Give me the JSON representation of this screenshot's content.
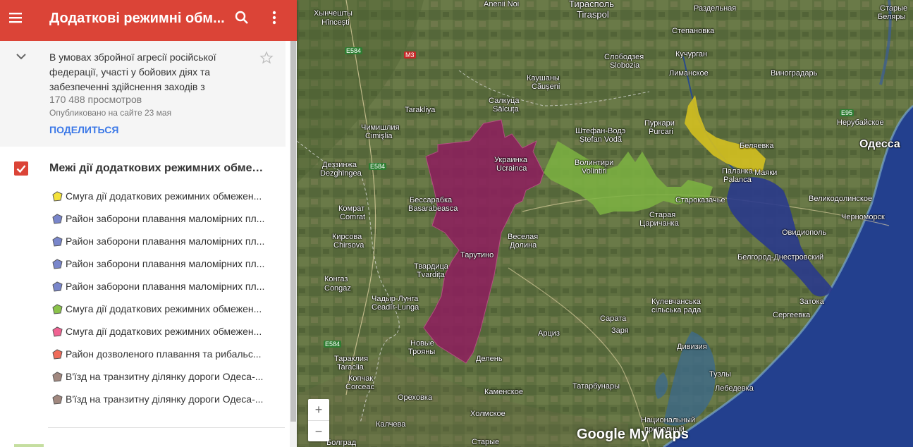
{
  "app": {
    "title": "Додаткові режимні обм...",
    "description": "В умовах збройної агресії російської федерації, участі у бойових діях та забезпеченні здійснення заходів з",
    "views": "170 488 просмотров",
    "published": "Опубликовано на сайте 23 мая",
    "share_label": "ПОДЕЛИТЬСЯ"
  },
  "layer": {
    "title": "Межі дії додаткових режимних обмеж...",
    "items": [
      {
        "label": "Смуга дії додаткових режимних обмежен...",
        "color": "#f4e23b"
      },
      {
        "label": "Район заборони плавання маломірних пл...",
        "color": "#7986cb"
      },
      {
        "label": "Район заборони плавання маломірних пл...",
        "color": "#7986cb"
      },
      {
        "label": "Район заборони плавання маломірних пл...",
        "color": "#7986cb"
      },
      {
        "label": "Район заборони плавання маломірних пл...",
        "color": "#7986cb"
      },
      {
        "label": "Смуга дії додаткових режимних обмежен...",
        "color": "#8bc34a"
      },
      {
        "label": "Смуга дії додаткових режимних обмежен...",
        "color": "#f06292"
      },
      {
        "label": "Район дозволеного плавання та рибальс...",
        "color": "#ef6c5a"
      },
      {
        "label": "В'їзд на транзитну ділянку дороги Одеса-...",
        "color": "#a1887f"
      },
      {
        "label": "В'їзд на транзитну ділянку дороги Одеса-...",
        "color": "#a1887f"
      }
    ]
  },
  "map": {
    "zoom_in": "+",
    "zoom_out": "−",
    "branding": "Google My Maps",
    "colors": {
      "yellow_zone": "#d4c020",
      "green_zone": "#7cb342",
      "purple_zone": "#8e1d5e",
      "blue_zone": "#2a3a8c",
      "sea": "#23408e"
    },
    "roads": [
      "E584",
      "M3",
      "E584",
      "E584",
      "E95"
    ],
    "places": [
      {
        "name": "Anenii Noi",
        "cls": ""
      },
      {
        "name": "Тирасполь",
        "cls": "mid"
      },
      {
        "name": "Tiraspol",
        "cls": "mid"
      },
      {
        "name": "Раздельная",
        "cls": ""
      },
      {
        "name": "Старые",
        "cls": ""
      },
      {
        "name": "Беляры",
        "cls": ""
      },
      {
        "name": "Хынчешты",
        "cls": ""
      },
      {
        "name": "Hîncești",
        "cls": ""
      },
      {
        "name": "Степановка",
        "cls": ""
      },
      {
        "name": "Кучурган",
        "cls": ""
      },
      {
        "name": "Слободзея",
        "cls": ""
      },
      {
        "name": "Slobozia",
        "cls": ""
      },
      {
        "name": "Лиманское",
        "cls": ""
      },
      {
        "name": "Виноградарь",
        "cls": ""
      },
      {
        "name": "Каушаны",
        "cls": ""
      },
      {
        "name": "Căușeni",
        "cls": ""
      },
      {
        "name": "Салкуца",
        "cls": ""
      },
      {
        "name": "Sălcuța",
        "cls": ""
      },
      {
        "name": "Tarakliya",
        "cls": ""
      },
      {
        "name": "Чимишлия",
        "cls": ""
      },
      {
        "name": "Cimişlia",
        "cls": ""
      },
      {
        "name": "Пуркари",
        "cls": ""
      },
      {
        "name": "Purcari",
        "cls": ""
      },
      {
        "name": "Штефан-Водэ",
        "cls": ""
      },
      {
        "name": "Ștefan Vodă",
        "cls": ""
      },
      {
        "name": "Нерубайское",
        "cls": ""
      },
      {
        "name": "Беляевка",
        "cls": ""
      },
      {
        "name": "Одесса",
        "cls": "big"
      },
      {
        "name": "Деззинжа",
        "cls": ""
      },
      {
        "name": "Dezghingea",
        "cls": ""
      },
      {
        "name": "Украинка",
        "cls": ""
      },
      {
        "name": "Ucrainca",
        "cls": ""
      },
      {
        "name": "Волинтири",
        "cls": ""
      },
      {
        "name": "Volintiri",
        "cls": ""
      },
      {
        "name": "Паланка",
        "cls": ""
      },
      {
        "name": "Palanca",
        "cls": ""
      },
      {
        "name": "Маяки",
        "cls": ""
      },
      {
        "name": "Бессарабка",
        "cls": ""
      },
      {
        "name": "Basarabeasca",
        "cls": ""
      },
      {
        "name": "Старокaзачье",
        "cls": ""
      },
      {
        "name": "Великодолинское",
        "cls": ""
      },
      {
        "name": "Комрат",
        "cls": ""
      },
      {
        "name": "Comrat",
        "cls": ""
      },
      {
        "name": "Старая",
        "cls": ""
      },
      {
        "name": "Царичанка",
        "cls": ""
      },
      {
        "name": "Черноморск",
        "cls": ""
      },
      {
        "name": "Кирсова",
        "cls": ""
      },
      {
        "name": "Chirsova",
        "cls": ""
      },
      {
        "name": "Веселая",
        "cls": ""
      },
      {
        "name": "Долина",
        "cls": ""
      },
      {
        "name": "Овидиополь",
        "cls": ""
      },
      {
        "name": "Тарутино",
        "cls": ""
      },
      {
        "name": "Белгород-Днестровский",
        "cls": ""
      },
      {
        "name": "Твардица",
        "cls": ""
      },
      {
        "name": "Tvardița",
        "cls": ""
      },
      {
        "name": "Конгаз",
        "cls": ""
      },
      {
        "name": "Congaz",
        "cls": ""
      },
      {
        "name": "Кулевчанська",
        "cls": ""
      },
      {
        "name": "сільська рада",
        "cls": ""
      },
      {
        "name": "Затока",
        "cls": ""
      },
      {
        "name": "Чадыр-Лунга",
        "cls": ""
      },
      {
        "name": "Ceadîr-Lunga",
        "cls": ""
      },
      {
        "name": "Сарата",
        "cls": ""
      },
      {
        "name": "Заря",
        "cls": ""
      },
      {
        "name": "Сергеевка",
        "cls": ""
      },
      {
        "name": "Арциз",
        "cls": ""
      },
      {
        "name": "Новые",
        "cls": ""
      },
      {
        "name": "Трояны",
        "cls": ""
      },
      {
        "name": "Дивизия",
        "cls": ""
      },
      {
        "name": "Тараклия",
        "cls": ""
      },
      {
        "name": "Taraclia",
        "cls": ""
      },
      {
        "name": "Делень",
        "cls": ""
      },
      {
        "name": "Копчак",
        "cls": ""
      },
      {
        "name": "Corсеас",
        "cls": ""
      },
      {
        "name": "Тузлы",
        "cls": ""
      },
      {
        "name": "Татарбунары",
        "cls": ""
      },
      {
        "name": "Лебедевка",
        "cls": ""
      },
      {
        "name": "Каменское",
        "cls": ""
      },
      {
        "name": "Ореховка",
        "cls": ""
      },
      {
        "name": "Национальный",
        "cls": ""
      },
      {
        "name": "природный",
        "cls": ""
      },
      {
        "name": "Холмское",
        "cls": ""
      },
      {
        "name": "Калчева",
        "cls": ""
      },
      {
        "name": "Болград",
        "cls": ""
      },
      {
        "name": "Старые",
        "cls": ""
      }
    ]
  }
}
